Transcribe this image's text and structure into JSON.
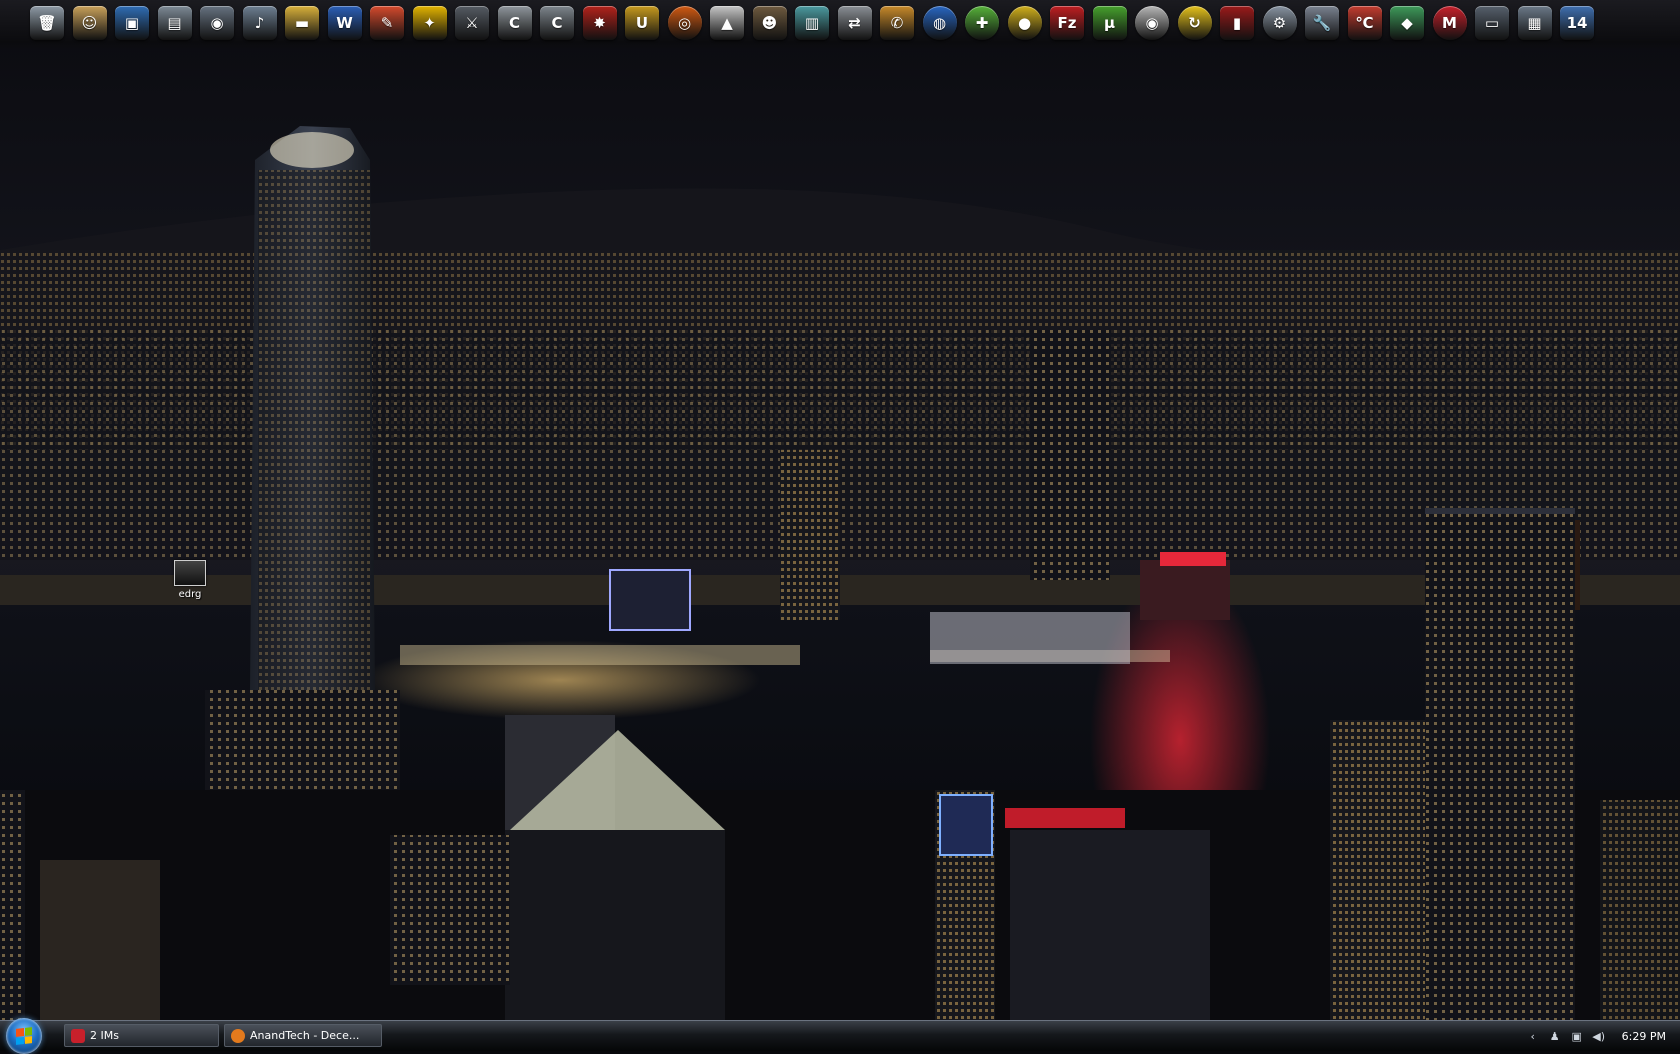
{
  "desktop": {
    "icons": [
      {
        "label": "edrg"
      }
    ]
  },
  "dock": {
    "icons": [
      {
        "name": "recycle-bin",
        "glyph": "🗑",
        "color": "#8e9aa6"
      },
      {
        "name": "contacts",
        "glyph": "☺",
        "color": "#c9a15a"
      },
      {
        "name": "computer",
        "glyph": "▣",
        "color": "#2f6db5"
      },
      {
        "name": "documents",
        "glyph": "▤",
        "color": "#7d8a96"
      },
      {
        "name": "camera",
        "glyph": "◉",
        "color": "#667280"
      },
      {
        "name": "music",
        "glyph": "♪",
        "color": "#6d7f92"
      },
      {
        "name": "folder",
        "glyph": "▬",
        "color": "#d9b13b"
      },
      {
        "name": "word",
        "glyph": "W",
        "color": "#2b5fb8"
      },
      {
        "name": "feather",
        "glyph": "✎",
        "color": "#d64a2d"
      },
      {
        "name": "aim",
        "glyph": "✦",
        "color": "#e3b400"
      },
      {
        "name": "game-1",
        "glyph": "⚔",
        "color": "#555b63"
      },
      {
        "name": "crysis",
        "glyph": "C",
        "color": "#8f969c"
      },
      {
        "name": "crysis-warhead",
        "glyph": "C",
        "color": "#7d858c"
      },
      {
        "name": "starcraft",
        "glyph": "✸",
        "color": "#b3221b"
      },
      {
        "name": "unreal",
        "glyph": "U",
        "color": "#c79a1e"
      },
      {
        "name": "target",
        "glyph": "◎",
        "color": "#d25a12"
      },
      {
        "name": "assassin",
        "glyph": "▲",
        "color": "#c6c6c6"
      },
      {
        "name": "soldier",
        "glyph": "☻",
        "color": "#6e5a3f"
      },
      {
        "name": "monitor",
        "glyph": "▥",
        "color": "#4b9aa0"
      },
      {
        "name": "remote",
        "glyph": "⇄",
        "color": "#8a8f95"
      },
      {
        "name": "phone",
        "glyph": "✆",
        "color": "#c88a2a"
      },
      {
        "name": "google-earth",
        "glyph": "◍",
        "color": "#2866c2"
      },
      {
        "name": "limewire",
        "glyph": "✚",
        "color": "#56b23a"
      },
      {
        "name": "disc",
        "glyph": "●",
        "color": "#d1b01c"
      },
      {
        "name": "filezilla",
        "glyph": "Fz",
        "color": "#bf1e21"
      },
      {
        "name": "utorrent",
        "glyph": "µ",
        "color": "#46a12d"
      },
      {
        "name": "cd-burner",
        "glyph": "◉",
        "color": "#b7b7b7"
      },
      {
        "name": "sync",
        "glyph": "↻",
        "color": "#e5c21c"
      },
      {
        "name": "vertical-app",
        "glyph": "▮",
        "color": "#9b1a1a"
      },
      {
        "name": "settings",
        "glyph": "⚙",
        "color": "#8894a2"
      },
      {
        "name": "wrench",
        "glyph": "🔧",
        "color": "#7a8290"
      },
      {
        "name": "thermometer",
        "glyph": "℃",
        "color": "#c43c2f"
      },
      {
        "name": "diamond",
        "glyph": "◆",
        "color": "#3e9a5a"
      },
      {
        "name": "mcafee",
        "glyph": "M",
        "color": "#c8202b"
      },
      {
        "name": "display",
        "glyph": "▭",
        "color": "#56606c"
      },
      {
        "name": "calculator",
        "glyph": "▦",
        "color": "#6b7988"
      },
      {
        "name": "calendar",
        "glyph": "14",
        "color": "#3f6fb0"
      }
    ]
  },
  "taskbar": {
    "tasks": [
      {
        "label": "2 IMs",
        "icon_color": "#c8202b"
      },
      {
        "label": "AnandTech - Dece...",
        "icon_color": "#e37a1d"
      }
    ],
    "tray": {
      "icons": [
        "chevron-left-icon",
        "user-icon",
        "network-icon",
        "volume-icon"
      ],
      "clock": "6:29 PM"
    }
  }
}
